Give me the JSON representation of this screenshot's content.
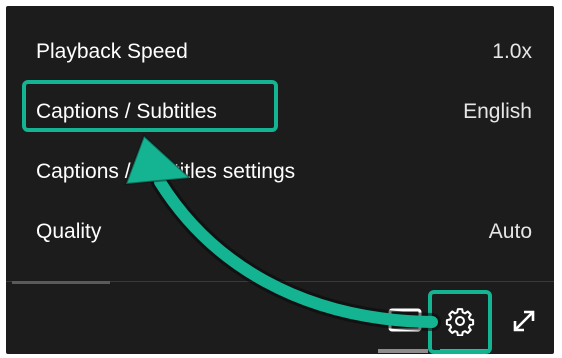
{
  "menu": {
    "items": [
      {
        "label": "Playback Speed",
        "value": "1.0x"
      },
      {
        "label": "Captions / Subtitles",
        "value": "English"
      },
      {
        "label": "Captions / Subtitles settings",
        "value": ""
      },
      {
        "label": "Quality",
        "value": "Auto"
      }
    ]
  },
  "controls": {
    "captions_icon": "closed-captions-icon",
    "settings_icon": "gear-icon",
    "fullscreen_icon": "fullscreen-icon"
  },
  "colors": {
    "panel_bg": "#1c1c1c",
    "text": "#ffffff",
    "annotation": "#14b392"
  }
}
